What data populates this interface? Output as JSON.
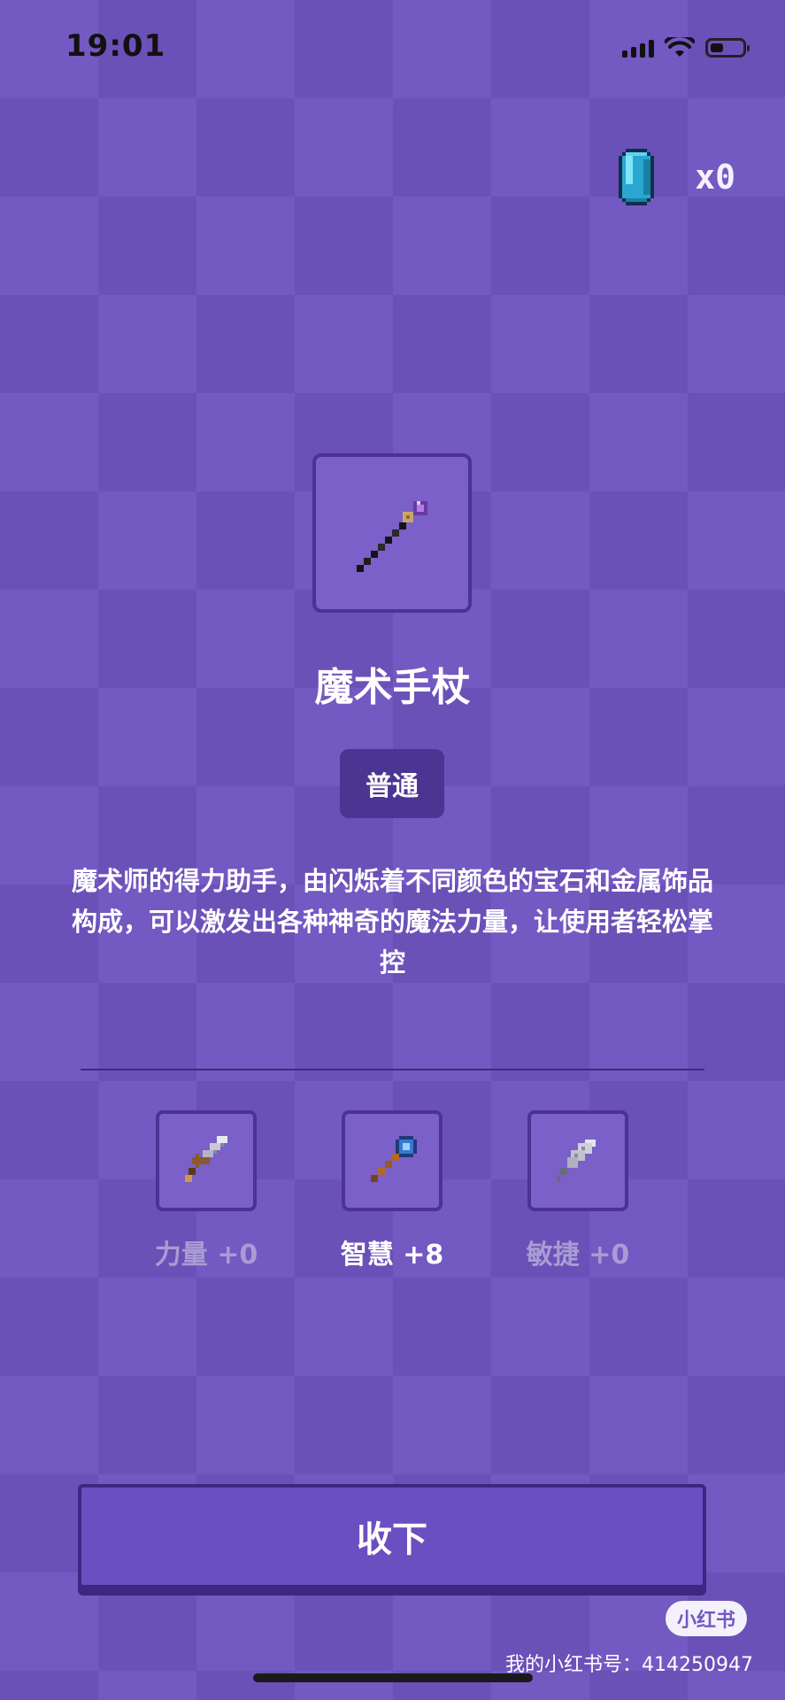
{
  "status_bar": {
    "time": "19:01"
  },
  "currency": {
    "icon": "gem-icon",
    "count": "x0"
  },
  "item": {
    "icon": "magic-staff-icon",
    "name": "魔术手杖",
    "rarity": "普通",
    "description": "魔术师的得力助手，由闪烁着不同颜色的宝石和金属饰品构成，可以激发出各种神奇的魔法力量，让使用者轻松掌控"
  },
  "stats": [
    {
      "icon": "sword-icon",
      "label": "力量 +0",
      "active": false
    },
    {
      "icon": "wand-icon",
      "label": "智慧 +8",
      "active": true
    },
    {
      "icon": "feather-icon",
      "label": "敏捷 +0",
      "active": false
    }
  ],
  "actions": {
    "collect_label": "收下"
  },
  "watermark": {
    "badge": "小红书",
    "text": "我的小红书号：414250947"
  },
  "colors": {
    "background": "#7359c2",
    "checker": "#6a51b8",
    "panel_border": "#4a3394",
    "rarity_bg": "#4b3592"
  }
}
